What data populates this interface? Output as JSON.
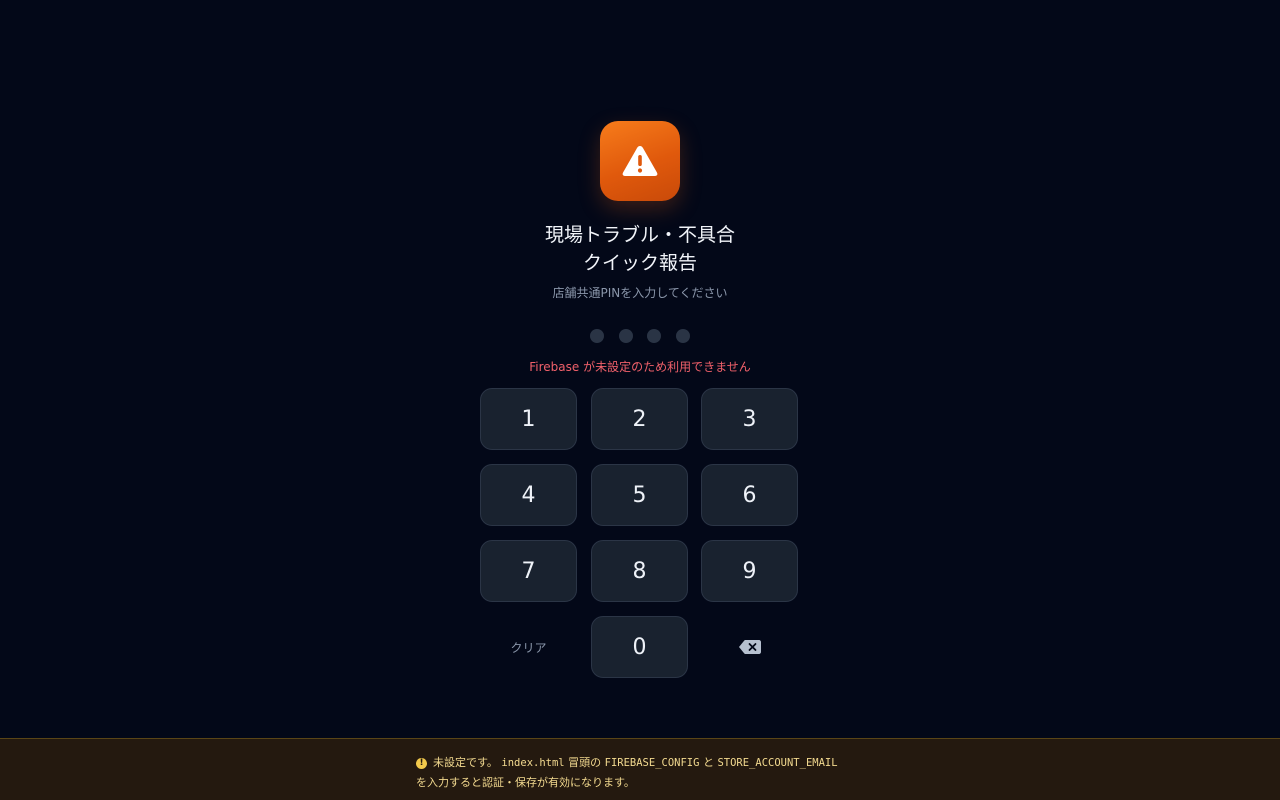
{
  "header": {
    "icon": "warning-triangle-icon",
    "title_line1": "現場トラブル・不具合",
    "title_line2": "クイック報告",
    "subtitle": "店舗共通PINを入力してください"
  },
  "pin": {
    "length": 4,
    "filled": 0
  },
  "error": "Firebase が未設定のため利用できません",
  "keypad": {
    "keys": [
      "1",
      "2",
      "3",
      "4",
      "5",
      "6",
      "7",
      "8",
      "9"
    ],
    "zero": "0",
    "clear_label": "クリア",
    "backspace_icon": "backspace-icon"
  },
  "notice": {
    "icon": "info-icon",
    "part1": "未設定です。",
    "code1": "index.html",
    "part2": "冒頭の",
    "code2": "FIREBASE_CONFIG",
    "part3": "と",
    "code3": "STORE_ACCOUNT_EMAIL",
    "line2": "を入力すると認証・保存が有効になります。"
  },
  "colors": {
    "background": "#030818",
    "accent": "#f0701a",
    "error": "#f0606a",
    "notice_bg": "#24190f",
    "notice_text": "#f2d98f"
  }
}
